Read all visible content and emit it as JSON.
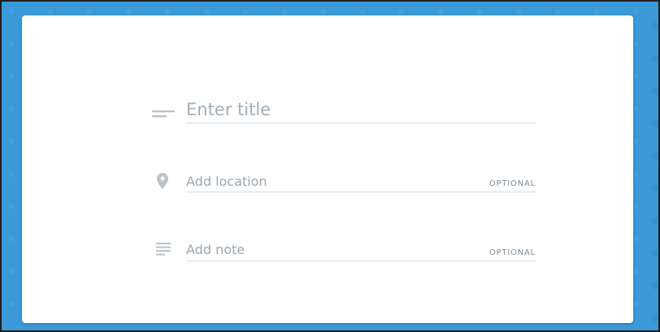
{
  "form": {
    "title_field": {
      "placeholder": "Enter title",
      "icon": "short-text-icon"
    },
    "location_field": {
      "placeholder": "Add location",
      "tag": "OPTIONAL",
      "icon": "location-pin-icon"
    },
    "note_field": {
      "placeholder": "Add note",
      "tag": "OPTIONAL",
      "icon": "notes-icon"
    }
  },
  "colors": {
    "backdrop": "#3a99d8",
    "card": "#ffffff",
    "icon": "#b8c3cc",
    "placeholder": "#9aa7b2",
    "underline": "#d4dbe1"
  }
}
